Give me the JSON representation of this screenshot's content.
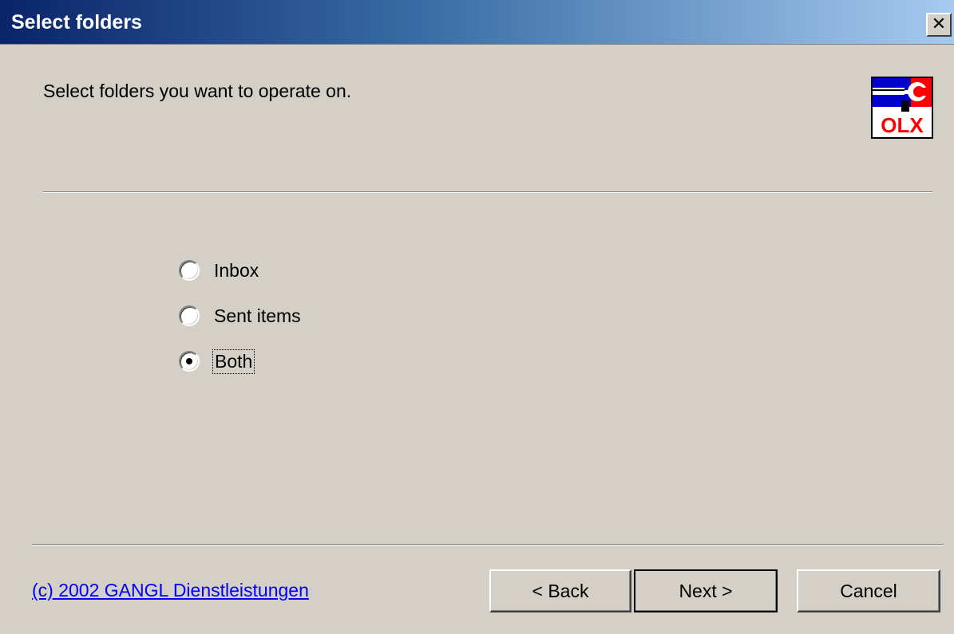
{
  "window": {
    "title": "Select folders",
    "close_icon": "close-icon",
    "close_glyph": "✕"
  },
  "header": {
    "instruction": "Select folders you want to operate on.",
    "logo_text": "OLX",
    "logo_icon": "olx-logo-icon",
    "logo_colors": {
      "blue": "#0000cc",
      "red": "#ff0000",
      "white": "#ffffff",
      "black": "#000000"
    }
  },
  "options": {
    "items": [
      {
        "label": "Inbox",
        "selected": false
      },
      {
        "label": "Sent items",
        "selected": false
      },
      {
        "label": "Both",
        "selected": true
      }
    ]
  },
  "footer": {
    "copyright_link": "(c) 2002 GANGL Dienstleistungen",
    "back_label": "< Back",
    "next_label": "Next >",
    "cancel_label": "Cancel"
  },
  "colors": {
    "dialog_bg": "#d4d0c8",
    "title_gradient_start": "#0a246a",
    "title_gradient_end": "#a6caf0",
    "link": "#0000ff"
  }
}
